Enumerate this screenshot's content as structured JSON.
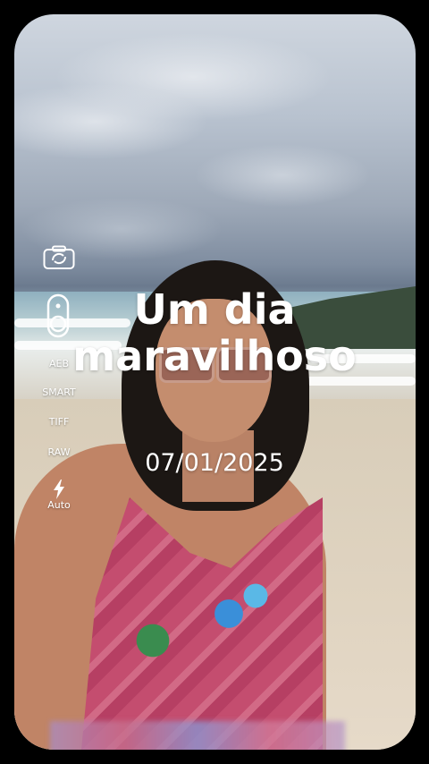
{
  "overlay": {
    "title_line1": "Um dia",
    "title_line2": "maravilhoso",
    "date": "07/01/2025"
  },
  "camera_controls": {
    "icons": [
      "camera-switch-icon",
      "shutter-toggle-icon",
      "flash-bolt-icon"
    ],
    "aeb": "AEB",
    "smart": "SMART",
    "tiff": "TIFF",
    "raw": "RAW",
    "flash_mode": "Auto"
  }
}
